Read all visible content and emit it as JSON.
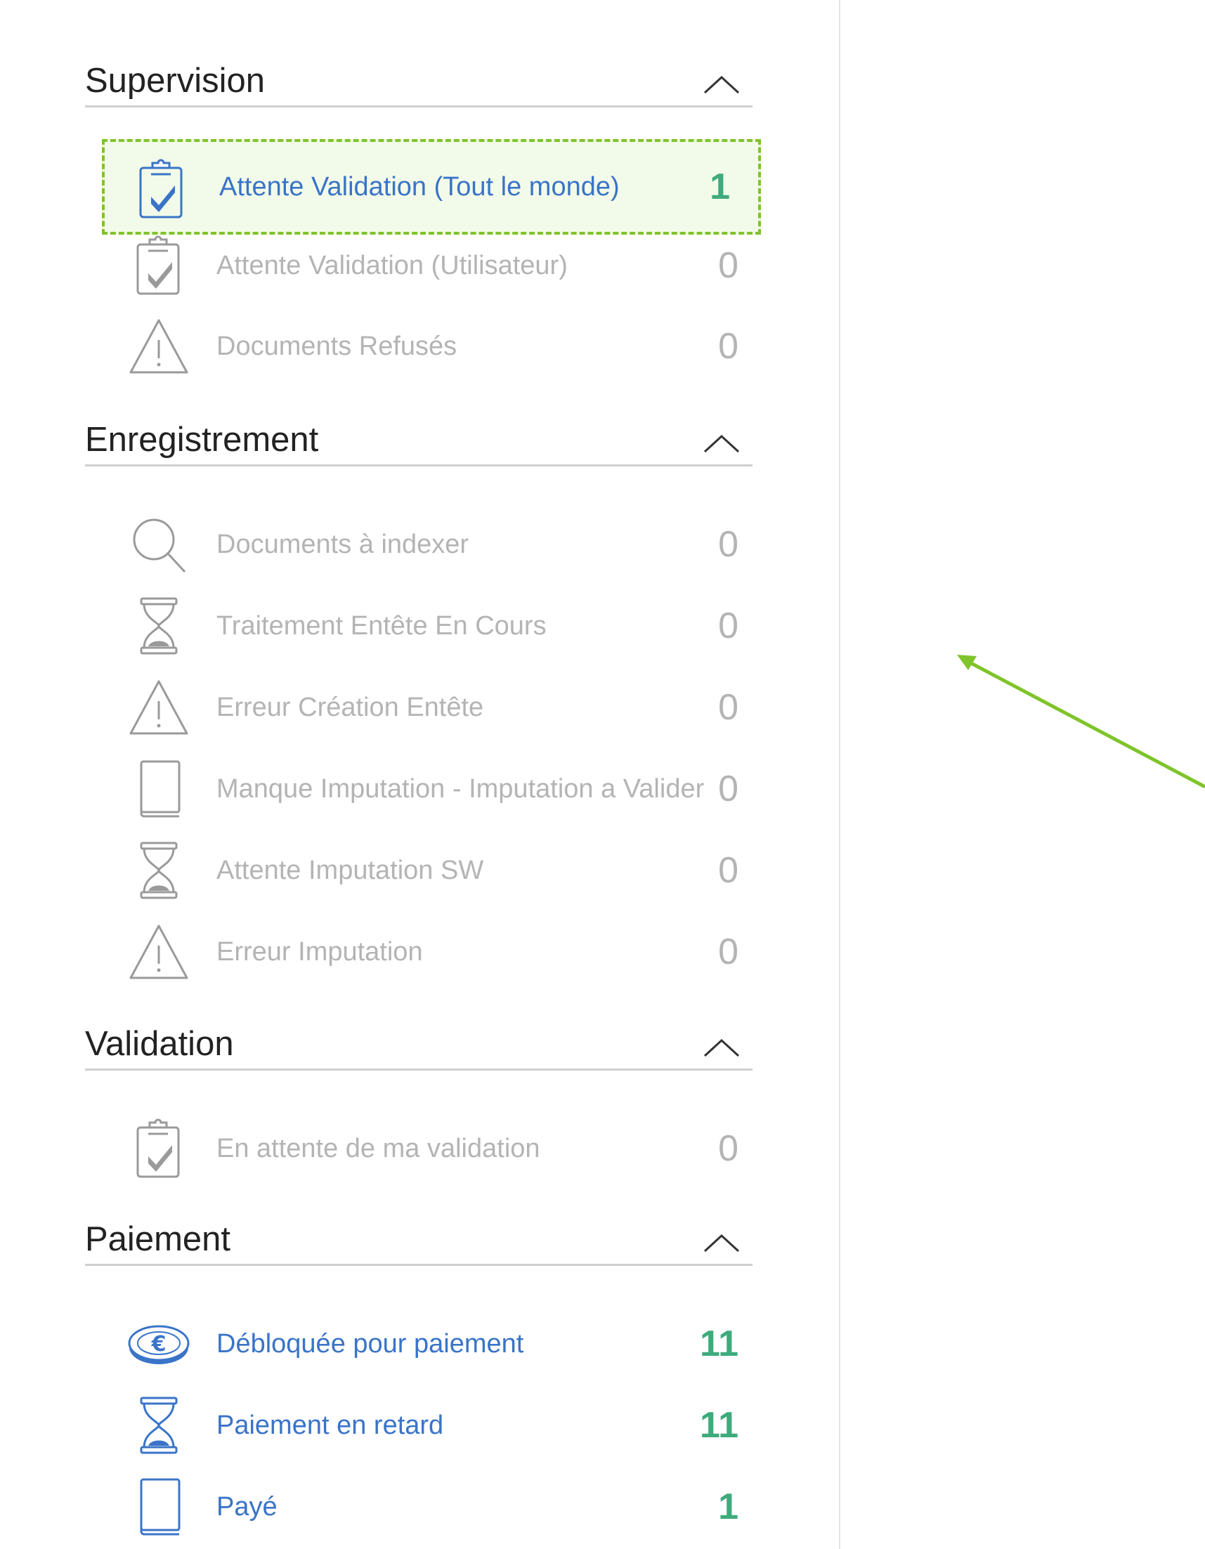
{
  "sections": [
    {
      "title": "Supervision",
      "items": [
        {
          "label": "Attente Validation (Tout le monde)",
          "count": "1",
          "icon": "clipboard-check-icon"
        },
        {
          "label": "Attente Validation (Utilisateur)",
          "count": "0",
          "icon": "clipboard-check-icon"
        },
        {
          "label": "Documents Refusés",
          "count": "0",
          "icon": "warning-triangle-icon"
        }
      ]
    },
    {
      "title": "Enregistrement",
      "items": [
        {
          "label": "Documents à indexer",
          "count": "0",
          "icon": "search-icon"
        },
        {
          "label": "Traitement Entête En Cours",
          "count": "0",
          "icon": "hourglass-icon"
        },
        {
          "label": "Erreur Création Entête",
          "count": "0",
          "icon": "warning-triangle-icon"
        },
        {
          "label": "Manque Imputation - Imputation a Valider",
          "count": "0",
          "icon": "book-icon"
        },
        {
          "label": "Attente Imputation SW",
          "count": "0",
          "icon": "hourglass-icon"
        },
        {
          "label": "Erreur Imputation",
          "count": "0",
          "icon": "warning-triangle-icon"
        }
      ]
    },
    {
      "title": "Validation",
      "items": [
        {
          "label": "En attente de ma validation",
          "count": "0",
          "icon": "clipboard-check-icon"
        }
      ]
    },
    {
      "title": "Paiement",
      "items": [
        {
          "label": "Débloquée pour paiement",
          "count": "11",
          "icon": "euro-coin-icon"
        },
        {
          "label": "Paiement en retard",
          "count": "11",
          "icon": "hourglass-icon"
        },
        {
          "label": "Payé",
          "count": "1",
          "icon": "book-icon"
        }
      ]
    }
  ],
  "colors": {
    "active_label": "#3a74c8",
    "active_count": "#3dab7c",
    "inactive": "#b4b4b4",
    "highlight_border": "#7fc42a",
    "highlight_fill": "#f2fbe9",
    "arrow": "#7fc42a"
  }
}
